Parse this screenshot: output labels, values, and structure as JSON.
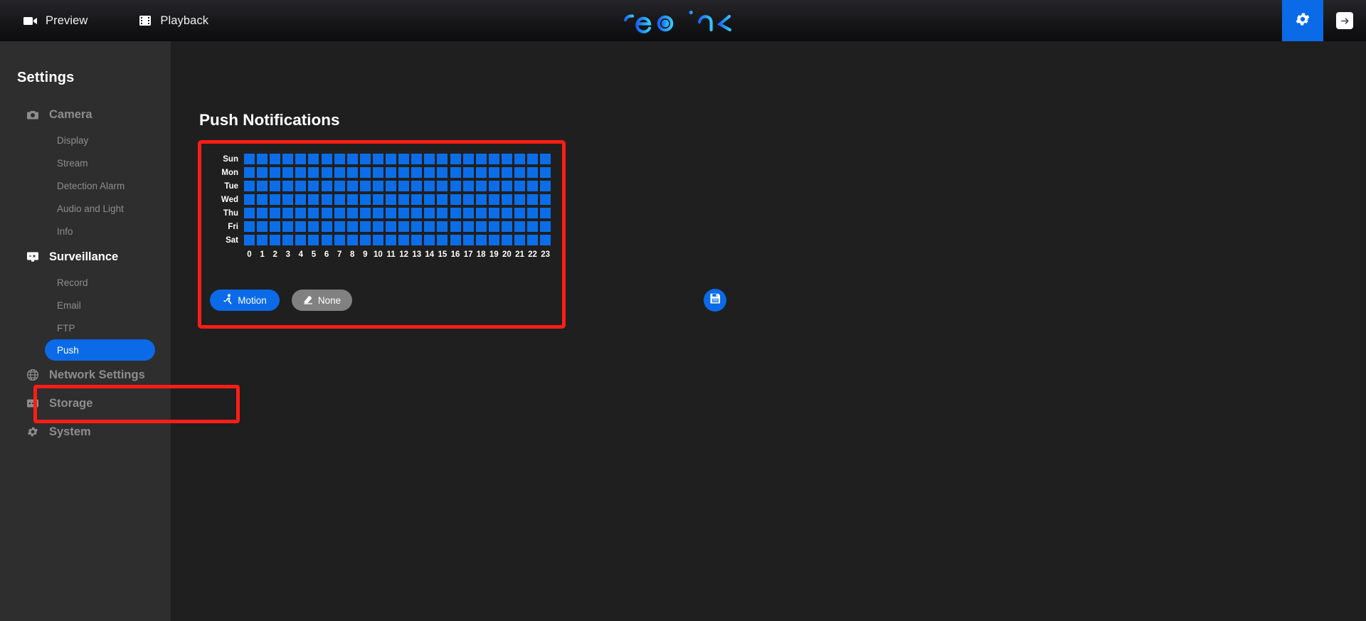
{
  "topbar": {
    "items": [
      {
        "label": "Preview",
        "icon": "video-camera-icon"
      },
      {
        "label": "Playback",
        "icon": "film-strip-icon"
      }
    ],
    "logo_text": "reolink",
    "settings_icon": "gear-icon",
    "exit_icon": "exit-arrow-icon",
    "accent": "#0a6ae8"
  },
  "sidebar": {
    "title": "Settings",
    "groups": [
      {
        "label": "Camera",
        "icon": "camera-icon",
        "active": false,
        "items": [
          {
            "label": "Display",
            "selected": false
          },
          {
            "label": "Stream",
            "selected": false
          },
          {
            "label": "Detection Alarm",
            "selected": false
          },
          {
            "label": "Audio and Light",
            "selected": false
          },
          {
            "label": "Info",
            "selected": false
          }
        ]
      },
      {
        "label": "Surveillance",
        "icon": "monitor-icon",
        "active": true,
        "items": [
          {
            "label": "Record",
            "selected": false
          },
          {
            "label": "Email",
            "selected": false
          },
          {
            "label": "FTP",
            "selected": false
          },
          {
            "label": "Push",
            "selected": true
          }
        ]
      },
      {
        "label": "Network Settings",
        "icon": "globe-icon",
        "active": false,
        "items": []
      },
      {
        "label": "Storage",
        "icon": "storage-icon",
        "active": false,
        "items": []
      },
      {
        "label": "System",
        "icon": "gear-icon",
        "active": false,
        "items": []
      }
    ]
  },
  "main": {
    "page_title": "Push Notifications",
    "schedule": {
      "days": [
        "Sun",
        "Mon",
        "Tue",
        "Wed",
        "Thu",
        "Fri",
        "Sat"
      ],
      "hours": [
        "0",
        "1",
        "2",
        "3",
        "4",
        "5",
        "6",
        "7",
        "8",
        "9",
        "10",
        "11",
        "12",
        "13",
        "14",
        "15",
        "16",
        "17",
        "18",
        "19",
        "20",
        "21",
        "22",
        "23"
      ],
      "selected_color": "#0b6ee8",
      "empty_color": "#1f1f1f",
      "cells": [
        [
          1,
          1,
          1,
          1,
          1,
          1,
          1,
          1,
          1,
          1,
          1,
          1,
          1,
          1,
          1,
          1,
          1,
          1,
          1,
          1,
          1,
          1,
          1,
          1
        ],
        [
          1,
          1,
          1,
          1,
          1,
          1,
          1,
          1,
          1,
          1,
          1,
          1,
          1,
          1,
          1,
          1,
          1,
          1,
          1,
          1,
          1,
          1,
          1,
          1
        ],
        [
          1,
          1,
          1,
          1,
          1,
          1,
          1,
          1,
          1,
          1,
          1,
          1,
          1,
          1,
          1,
          1,
          1,
          1,
          1,
          1,
          1,
          1,
          1,
          1
        ],
        [
          1,
          1,
          1,
          1,
          1,
          1,
          1,
          1,
          1,
          1,
          1,
          1,
          1,
          1,
          1,
          1,
          1,
          1,
          1,
          1,
          1,
          1,
          1,
          1
        ],
        [
          1,
          1,
          1,
          1,
          1,
          1,
          1,
          1,
          1,
          1,
          1,
          1,
          1,
          1,
          1,
          1,
          1,
          1,
          1,
          1,
          1,
          1,
          1,
          1
        ],
        [
          1,
          1,
          1,
          1,
          1,
          1,
          1,
          1,
          1,
          1,
          1,
          1,
          1,
          1,
          1,
          1,
          1,
          1,
          1,
          1,
          1,
          1,
          1,
          1
        ],
        [
          1,
          1,
          1,
          1,
          1,
          1,
          1,
          1,
          1,
          1,
          1,
          1,
          1,
          1,
          1,
          1,
          1,
          1,
          1,
          1,
          1,
          1,
          1,
          1
        ]
      ]
    },
    "controls": {
      "motion_label": "Motion",
      "motion_icon": "running-person-icon",
      "motion_active": true,
      "none_label": "None",
      "none_icon": "eraser-icon",
      "none_active": false,
      "save_icon": "floppy-disk-save-icon"
    }
  },
  "annotations": {
    "color": "#fe1d16",
    "boxes": [
      "push-sidebar-item",
      "schedule-panel"
    ]
  }
}
